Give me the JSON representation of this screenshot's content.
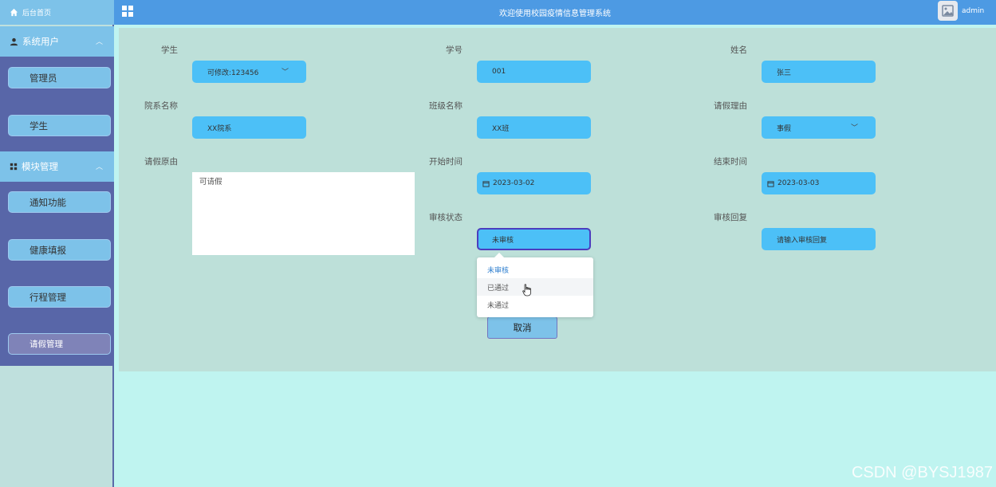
{
  "header": {
    "title": "欢迎使用校园疫情信息管理系统",
    "user": "admin"
  },
  "sidebar": {
    "home": "后台首页",
    "groups": [
      {
        "label": "系统用户",
        "items": [
          "管理员",
          "学生"
        ]
      },
      {
        "label": "模块管理",
        "items": [
          "通知功能",
          "健康填报",
          "行程管理",
          "请假管理"
        ]
      }
    ],
    "active_item": "请假管理"
  },
  "form": {
    "student": {
      "label": "学生",
      "value": "可修改:123456"
    },
    "student_no": {
      "label": "学号",
      "value": "001"
    },
    "name": {
      "label": "姓名",
      "value": "张三"
    },
    "dept": {
      "label": "院系名称",
      "value": "XX院系"
    },
    "class": {
      "label": "班级名称",
      "value": "XX班"
    },
    "leave_reason": {
      "label": "请假理由",
      "value": "事假"
    },
    "leave_cause": {
      "label": "请假原由",
      "value": "可请假"
    },
    "start_time": {
      "label": "开始时间",
      "value": "2023-03-02"
    },
    "end_time": {
      "label": "结束时间",
      "value": "2023-03-03"
    },
    "review_status": {
      "label": "审核状态",
      "value": "未审核"
    },
    "review_reply": {
      "label": "审核回复",
      "placeholder": "请输入审核回复"
    }
  },
  "dropdown": {
    "options": [
      "未审核",
      "已通过",
      "未通过"
    ],
    "selected": "未审核",
    "hovered": "已通过"
  },
  "buttons": {
    "cancel": "取消"
  },
  "watermark": "CSDN @BYSJ1987",
  "colors": {
    "header": "#4d9ae3",
    "sidebar_block": "#5866a8",
    "field": "#4cc0f7",
    "panel": "#bde0d9",
    "background": "#bff4f0"
  }
}
